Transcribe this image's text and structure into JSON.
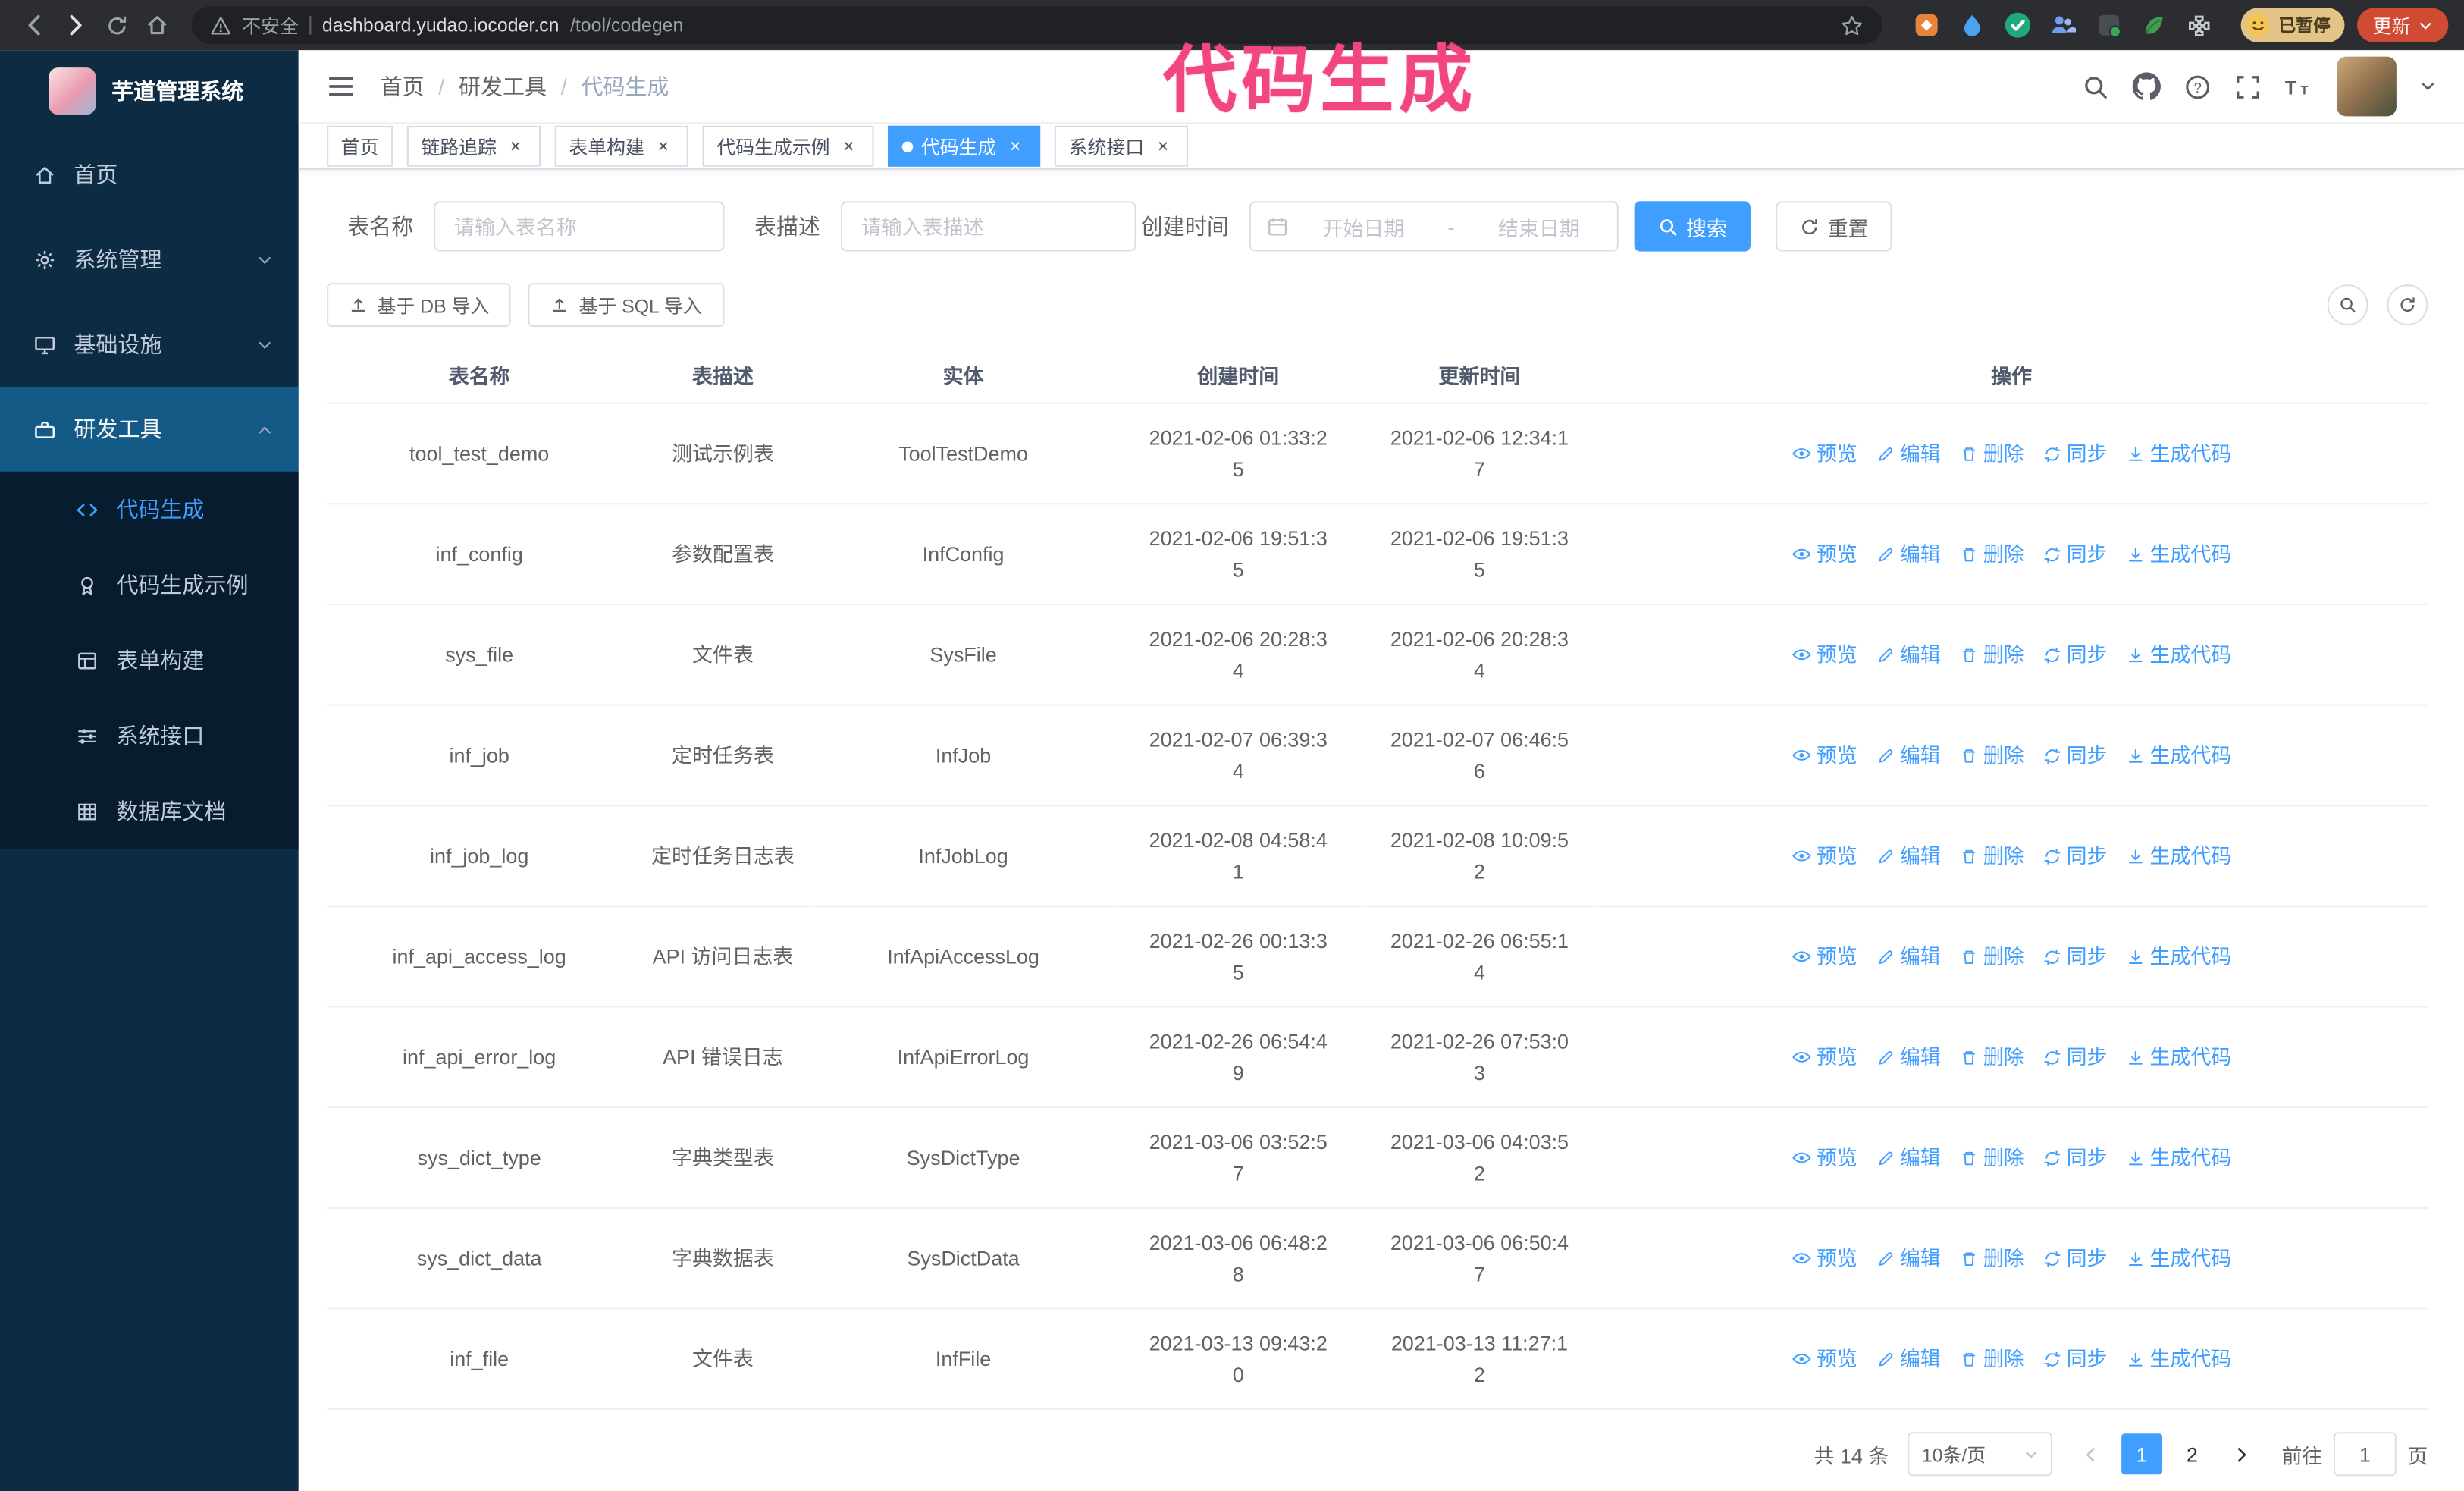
{
  "annotation": {
    "text": "代码生成",
    "color": "#f2477e"
  },
  "browser": {
    "insecure_label": "不安全",
    "url_host": "dashboard.yudao.iocoder.cn",
    "url_path": "/tool/codegen",
    "paused_badge": "已暂停",
    "update_button": "更新"
  },
  "sidebar": {
    "logo_title": "芋道管理系统",
    "items": [
      {
        "label": "首页",
        "icon": "home-icon"
      },
      {
        "label": "系统管理",
        "icon": "gear-icon"
      },
      {
        "label": "基础设施",
        "icon": "monitor-icon"
      },
      {
        "label": "研发工具",
        "icon": "toolbox-icon"
      },
      {
        "label": "代码生成",
        "icon": "code-icon"
      },
      {
        "label": "代码生成示例",
        "icon": "medal-icon"
      },
      {
        "label": "表单构建",
        "icon": "form-icon"
      },
      {
        "label": "系统接口",
        "icon": "sliders-icon"
      },
      {
        "label": "数据库文档",
        "icon": "table-grid-icon"
      }
    ]
  },
  "header": {
    "breadcrumb": [
      "首页",
      "研发工具",
      "代码生成"
    ],
    "icon_names": [
      "search-icon",
      "github-icon",
      "help-icon",
      "fullscreen-icon",
      "font-size-icon"
    ]
  },
  "tabs": [
    {
      "label": "首页"
    },
    {
      "label": "链路追踪"
    },
    {
      "label": "表单构建"
    },
    {
      "label": "代码生成示例"
    },
    {
      "label": "代码生成"
    },
    {
      "label": "系统接口"
    }
  ],
  "filters": {
    "table_name_label": "表名称",
    "table_name_placeholder": "请输入表名称",
    "table_desc_label": "表描述",
    "table_desc_placeholder": "请输入表描述",
    "create_time_label": "创建时间",
    "date_start_placeholder": "开始日期",
    "date_separator": "-",
    "date_end_placeholder": "结束日期",
    "search_button": "搜索",
    "reset_button": "重置"
  },
  "toolbar": {
    "import_db_button": "基于 DB 导入",
    "import_sql_button": "基于 SQL 导入"
  },
  "table": {
    "columns": [
      "表名称",
      "表描述",
      "实体",
      "创建时间",
      "更新时间",
      "操作"
    ],
    "actions": [
      "预览",
      "编辑",
      "删除",
      "同步",
      "生成代码"
    ],
    "rows": [
      {
        "name": "tool_test_demo",
        "desc": "测试示例表",
        "entity": "ToolTestDemo",
        "created": "2021-02-06 01:33:25",
        "updated": "2021-02-06 12:34:17"
      },
      {
        "name": "inf_config",
        "desc": "参数配置表",
        "entity": "InfConfig",
        "created": "2021-02-06 19:51:35",
        "updated": "2021-02-06 19:51:35"
      },
      {
        "name": "sys_file",
        "desc": "文件表",
        "entity": "SysFile",
        "created": "2021-02-06 20:28:34",
        "updated": "2021-02-06 20:28:34"
      },
      {
        "name": "inf_job",
        "desc": "定时任务表",
        "entity": "InfJob",
        "created": "2021-02-07 06:39:34",
        "updated": "2021-02-07 06:46:56"
      },
      {
        "name": "inf_job_log",
        "desc": "定时任务日志表",
        "entity": "InfJobLog",
        "created": "2021-02-08 04:58:41",
        "updated": "2021-02-08 10:09:52"
      },
      {
        "name": "inf_api_access_log",
        "desc": "API 访问日志表",
        "entity": "InfApiAccessLog",
        "created": "2021-02-26 00:13:35",
        "updated": "2021-02-26 06:55:14"
      },
      {
        "name": "inf_api_error_log",
        "desc": "API 错误日志",
        "entity": "InfApiErrorLog",
        "created": "2021-02-26 06:54:49",
        "updated": "2021-02-26 07:53:03"
      },
      {
        "name": "sys_dict_type",
        "desc": "字典类型表",
        "entity": "SysDictType",
        "created": "2021-03-06 03:52:57",
        "updated": "2021-03-06 04:03:52"
      },
      {
        "name": "sys_dict_data",
        "desc": "字典数据表",
        "entity": "SysDictData",
        "created": "2021-03-06 06:48:28",
        "updated": "2021-03-06 06:50:47"
      },
      {
        "name": "inf_file",
        "desc": "文件表",
        "entity": "InfFile",
        "created": "2021-03-13 09:43:20",
        "updated": "2021-03-13 11:27:12"
      }
    ]
  },
  "pagination": {
    "total": "共 14 条",
    "page_size": "10条/页",
    "pages": [
      "1",
      "2"
    ],
    "active_page": "1",
    "goto_label": "前往",
    "goto_value": "1",
    "goto_suffix": "页"
  },
  "colors": {
    "accent": "#409eff",
    "sidebar_bg": "#0d2b43",
    "sidebar_submenu_bg": "#071c2e",
    "sidebar_active_bg": "#135a86",
    "annotation": "#f2477e",
    "update_button_bg": "#d04a34",
    "paused_badge_bg": "#e3c386",
    "tab_active_bg": "#409eff"
  }
}
